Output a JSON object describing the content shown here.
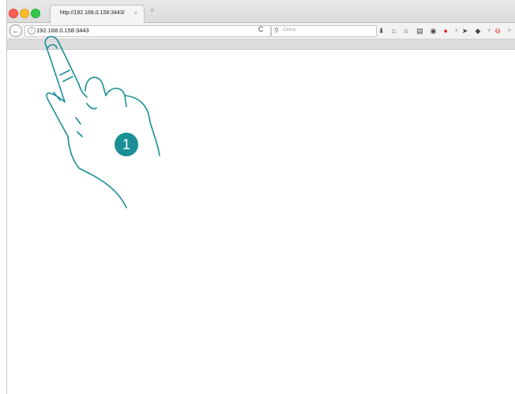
{
  "browser": {
    "tab": {
      "title": "http://192.168.0.158:3443/",
      "close": "×"
    },
    "new_tab": "+",
    "nav": {
      "back": "←",
      "info": "i",
      "reload": "C"
    },
    "address": {
      "value": "192.168.0.158:3443"
    },
    "search": {
      "placeholder": "Cerca"
    }
  },
  "toolbar": [
    {
      "name": "download-icon",
      "glyph": "⬇"
    },
    {
      "name": "home-icon",
      "glyph": "⌂"
    },
    {
      "name": "bookmark-star-icon",
      "glyph": "☆"
    },
    {
      "name": "clipboard-icon",
      "glyph": "▤"
    },
    {
      "name": "pocket-icon",
      "glyph": "◉"
    },
    {
      "name": "extension-icon",
      "glyph": "●"
    },
    {
      "name": "dropdown-arrow-icon",
      "glyph": "▾"
    },
    {
      "name": "send-icon",
      "glyph": "➤"
    },
    {
      "name": "extension-2-icon",
      "glyph": "◆"
    },
    {
      "name": "dropdown-arrow-2-icon",
      "glyph": "▾"
    },
    {
      "name": "stop-icon",
      "glyph": "⊖"
    },
    {
      "name": "dropdown-arrow-3-icon",
      "glyph": "▾"
    },
    {
      "name": "menu-icon",
      "glyph": "≡"
    }
  ],
  "annotation": {
    "step": "1"
  },
  "colors": {
    "accent": "#1b8f96"
  }
}
